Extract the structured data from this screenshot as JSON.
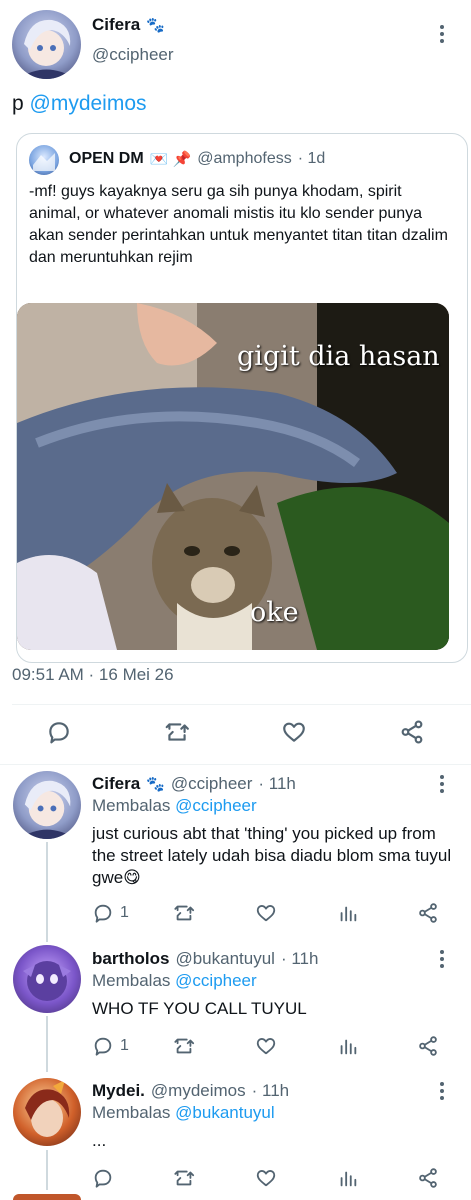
{
  "main_tweet": {
    "author_name": "Cifera",
    "author_emoji": "🐾",
    "author_handle": "@ccipheer",
    "text_prefix": "p ",
    "text_mention": "@mydeimos",
    "timestamp": "09:51 AM · 16 Mei 26"
  },
  "quoted_tweet": {
    "author_name": "OPEN DM",
    "author_emojis": "💌 📌",
    "author_handle": "@amphofess",
    "age": "· 1d",
    "text": "-mf! guys kayaknya seru ga sih punya khodam, spirit animal, or whatever anomali mistis itu klo sender punya akan sender perintahkan untuk menyantet titan titan dzalim dan meruntuhkan rejim",
    "image": {
      "caption_top": "gigit dia hasan",
      "caption_bottom": "oke"
    }
  },
  "replies": [
    {
      "author_name": "Cifera",
      "author_emoji": "🐾",
      "author_handle": "@ccipheer",
      "age": "· 11h",
      "replying_label": "Membalas",
      "replying_to": "@ccipheer",
      "text": "just curious abt that 'thing' you picked up from the street lately udah bisa diadu blom sma tuyul gwe😋",
      "reply_count": "1"
    },
    {
      "author_name": "bartholos",
      "author_emoji": "",
      "author_handle": "@bukantuyul",
      "age": "· 11h",
      "replying_label": "Membalas",
      "replying_to": "@ccipheer",
      "text": "WHO TF YOU CALL TUYUL",
      "reply_count": "1"
    },
    {
      "author_name": "Mydei.",
      "author_emoji": "",
      "author_handle": "@mydeimos",
      "age": "· 11h",
      "replying_label": "Membalas",
      "replying_to": "@bukantuyul",
      "text": "...",
      "reply_count": ""
    }
  ],
  "colors": {
    "accent": "#1d9bf0",
    "secondary_text": "#536471",
    "divider": "#eff3f4"
  }
}
